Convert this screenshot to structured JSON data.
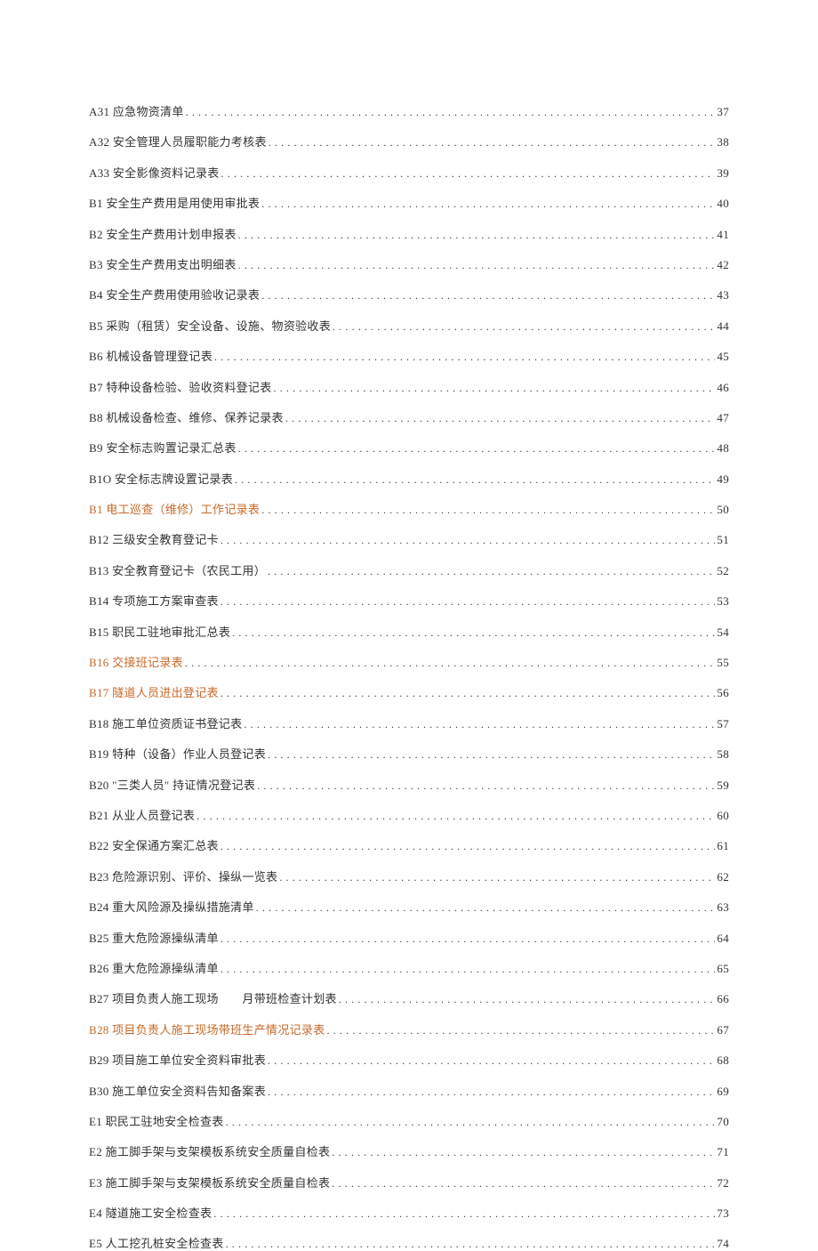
{
  "toc": {
    "entries": [
      {
        "label": "A31 应急物资清单",
        "page": "37",
        "style": "normal"
      },
      {
        "label": "A32 安全管理人员履职能力考核表",
        "page": "38",
        "style": "normal"
      },
      {
        "label": "A33 安全影像资料记录表",
        "page": "39",
        "style": "normal"
      },
      {
        "label": "B1 安全生产费用是用使用审批表",
        "page": "40",
        "style": "normal"
      },
      {
        "label": "B2 安全生产费用计划申报表",
        "page": "41",
        "style": "normal"
      },
      {
        "label": "B3 安全生产费用支出明细表",
        "page": "42",
        "style": "normal"
      },
      {
        "label": "B4 安全生产费用使用验收记录表",
        "page": "43",
        "style": "normal"
      },
      {
        "label": "B5 采购（租赁）安全设备、设施、物资验收表",
        "page": "44",
        "style": "normal"
      },
      {
        "label": "B6 机械设备管理登记表",
        "page": "45",
        "style": "normal"
      },
      {
        "label": "B7 特种设备检验、验收资料登记表",
        "page": "46",
        "style": "normal"
      },
      {
        "label": "B8 机械设备检查、维修、保养记录表",
        "page": "47",
        "style": "normal"
      },
      {
        "label": "B9 安全标志购置记录汇总表",
        "page": "48",
        "style": "normal"
      },
      {
        "label": "B1O 安全标志牌设置记录表",
        "page": "49",
        "style": "normal"
      },
      {
        "label": "B1 电工巡查（维修）工作记录表",
        "page": "50",
        "style": "orange"
      },
      {
        "label": "B12 三级安全教育登记卡",
        "page": "51",
        "style": "normal"
      },
      {
        "label": "B13 安全教育登记卡（农民工用）",
        "page": "52",
        "style": "normal"
      },
      {
        "label": "B14 专项施工方案审查表",
        "page": "53",
        "style": "normal"
      },
      {
        "label": "B15 职民工驻地审批汇总表",
        "page": "54",
        "style": "normal"
      },
      {
        "label": "B16 交接班记录表",
        "page": "55",
        "style": "orange"
      },
      {
        "label": "B17 隧道人员进出登记表",
        "page": "56",
        "style": "orange"
      },
      {
        "label": "B18 施工单位资质证书登记表",
        "page": "57",
        "style": "normal"
      },
      {
        "label": "B19 特种（设备）作业人员登记表",
        "page": "58",
        "style": "normal"
      },
      {
        "label": "B20 \"三类人员\" 持证情况登记表",
        "page": "59",
        "style": "normal"
      },
      {
        "label": "B21 从业人员登记表",
        "page": "60",
        "style": "normal"
      },
      {
        "label": "B22 安全保通方案汇总表",
        "page": "61",
        "style": "normal"
      },
      {
        "label": "B23 危险源识别、评价、操纵一览表",
        "page": "62",
        "style": "normal"
      },
      {
        "label": "B24 重大风险源及操纵措施清单",
        "page": "63",
        "style": "normal"
      },
      {
        "label": "B25 重大危险源操纵清单",
        "page": "64",
        "style": "normal"
      },
      {
        "label": "B26 重大危险源操纵清单",
        "page": "65",
        "style": "normal"
      },
      {
        "label": "B27 项目负责人施工现场　　月带班检查计划表",
        "page": "66",
        "style": "normal"
      },
      {
        "label": "B28 项目负责人施工现场带班生产情况记录表",
        "page": "67",
        "style": "orange"
      },
      {
        "label": "B29 项目施工单位安全资料审批表",
        "page": "68",
        "style": "normal"
      },
      {
        "label": "B30 施工单位安全资料告知备案表",
        "page": "69",
        "style": "normal"
      },
      {
        "label": "E1 职民工驻地安全检查表",
        "page": "70",
        "style": "normal"
      },
      {
        "label": "E2 施工脚手架与支架模板系统安全质量自检表",
        "page": "71",
        "style": "normal"
      },
      {
        "label": "E3 施工脚手架与支架模板系统安全质量自检表",
        "page": "72",
        "style": "normal"
      },
      {
        "label": "E4 隧道施工安全检查表",
        "page": "73",
        "style": "normal"
      },
      {
        "label": "E5 人工挖孔桩安全检查表",
        "page": "74",
        "style": "normal"
      }
    ]
  }
}
